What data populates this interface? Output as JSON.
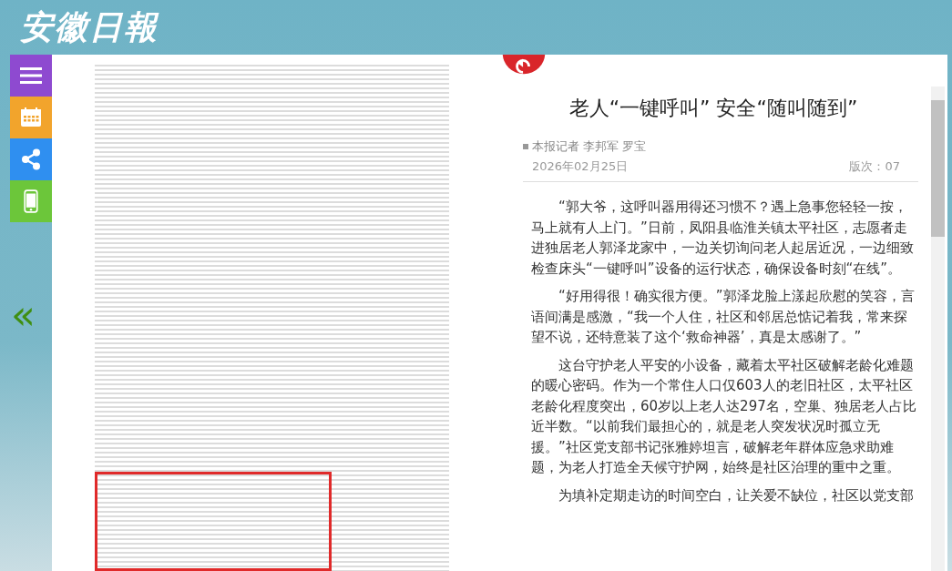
{
  "header": {
    "logo": "安徽日報"
  },
  "sidebar": {
    "buttons": [
      {
        "kind": "menu"
      },
      {
        "kind": "calendar"
      },
      {
        "kind": "share"
      },
      {
        "kind": "phone"
      }
    ]
  },
  "pager": {
    "previous": "«"
  },
  "article": {
    "title": "老人“一键呼叫” 安全“随叫随到”",
    "byline": "本报记者 李邦军 罗宝",
    "date": "2026年02月25日",
    "edition": "版次：07",
    "paragraphs": [
      "“郭大爷，这呼叫器用得还习惯不？遇上急事您轻轻一按，马上就有人上门。”日前，凤阳县临淮关镇太平社区，志愿者走进独居老人郭泽龙家中，一边关切询问老人起居近况，一边细致检查床头“一键呼叫”设备的运行状态，确保设备时刻“在线”。",
      "“好用得很！确实很方便。”郭泽龙脸上漾起欣慰的笑容，言语间满是感激，“我一个人住，社区和邻居总惦记着我，常来探望不说，还特意装了这个‘救命神器’，真是太感谢了。”",
      "这台守护老人平安的小设备，藏着太平社区破解老龄化难题的暖心密码。作为一个常住人口仅603人的老旧社区，太平社区老龄化程度突出，60岁以上老人达297名，空巢、独居老人占比近半数。“以前我们最担心的，就是老人突发状况时孤立无援。”社区党支部书记张雅婷坦言，破解老年群体应急求助难题，为老人打造全天候守护网，始终是社区治理的重中之重。",
      "为填补定期走访的时间空白，让关爱不缺位，社区以党支部"
    ]
  }
}
